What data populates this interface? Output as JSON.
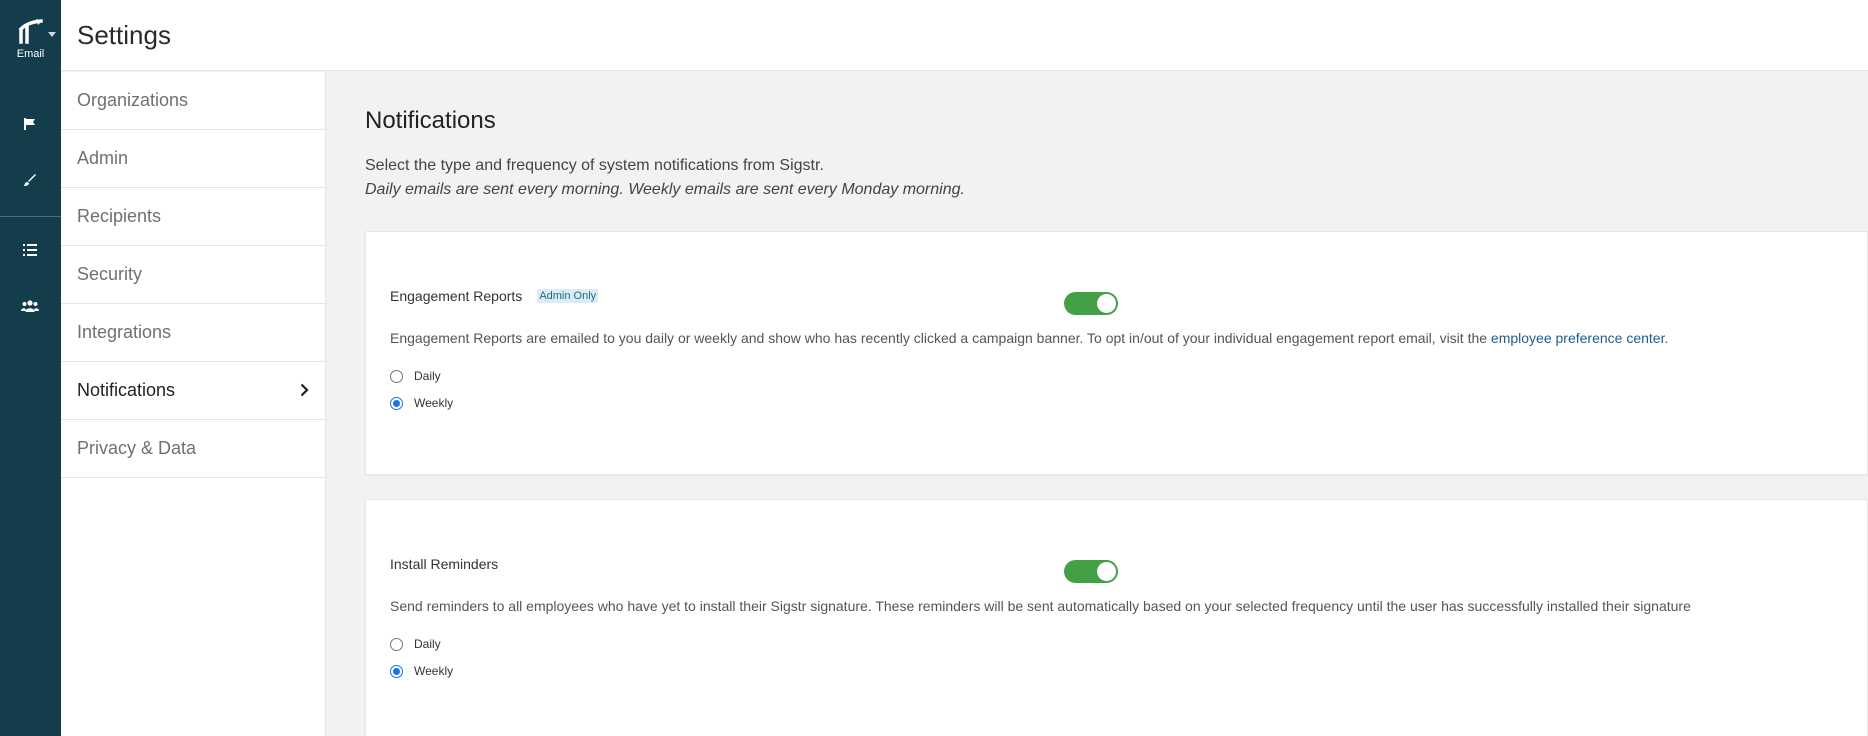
{
  "rail": {
    "logo_label": "Email",
    "icons": [
      "flag-icon",
      "brush-icon",
      "list-icon",
      "users-icon"
    ]
  },
  "header": {
    "title": "Settings"
  },
  "subnav": {
    "items": [
      {
        "label": "Organizations"
      },
      {
        "label": "Admin"
      },
      {
        "label": "Recipients"
      },
      {
        "label": "Security"
      },
      {
        "label": "Integrations"
      },
      {
        "label": "Notifications",
        "active": true
      },
      {
        "label": "Privacy & Data"
      }
    ]
  },
  "main": {
    "title": "Notifications",
    "intro_line1": "Select the type and frequency of system notifications from Sigstr.",
    "intro_line2": "Daily emails are sent every morning. Weekly emails are sent every Monday morning.",
    "cards": [
      {
        "title": "Engagement Reports",
        "badge": "Admin Only",
        "enabled": true,
        "description": "Engagement Reports are emailed to you daily or weekly and show who has recently clicked a campaign banner. To opt in/out of your individual engagement report email, visit the ",
        "link_text": "employee preference center",
        "description_end": ".",
        "options": [
          "Daily",
          "Weekly"
        ],
        "selected": "Weekly"
      },
      {
        "title": "Install Reminders",
        "enabled": true,
        "description": "Send reminders to all employees who have yet to install their Sigstr signature. These reminders will be sent automatically based on your selected frequency until the user has successfully installed their signature",
        "options": [
          "Daily",
          "Weekly"
        ],
        "selected": "Weekly"
      }
    ]
  },
  "colors": {
    "rail_bg": "#143d4c",
    "toggle_on": "#43a047",
    "link": "#1f5e8c",
    "radio_checked": "#1a73e8"
  }
}
